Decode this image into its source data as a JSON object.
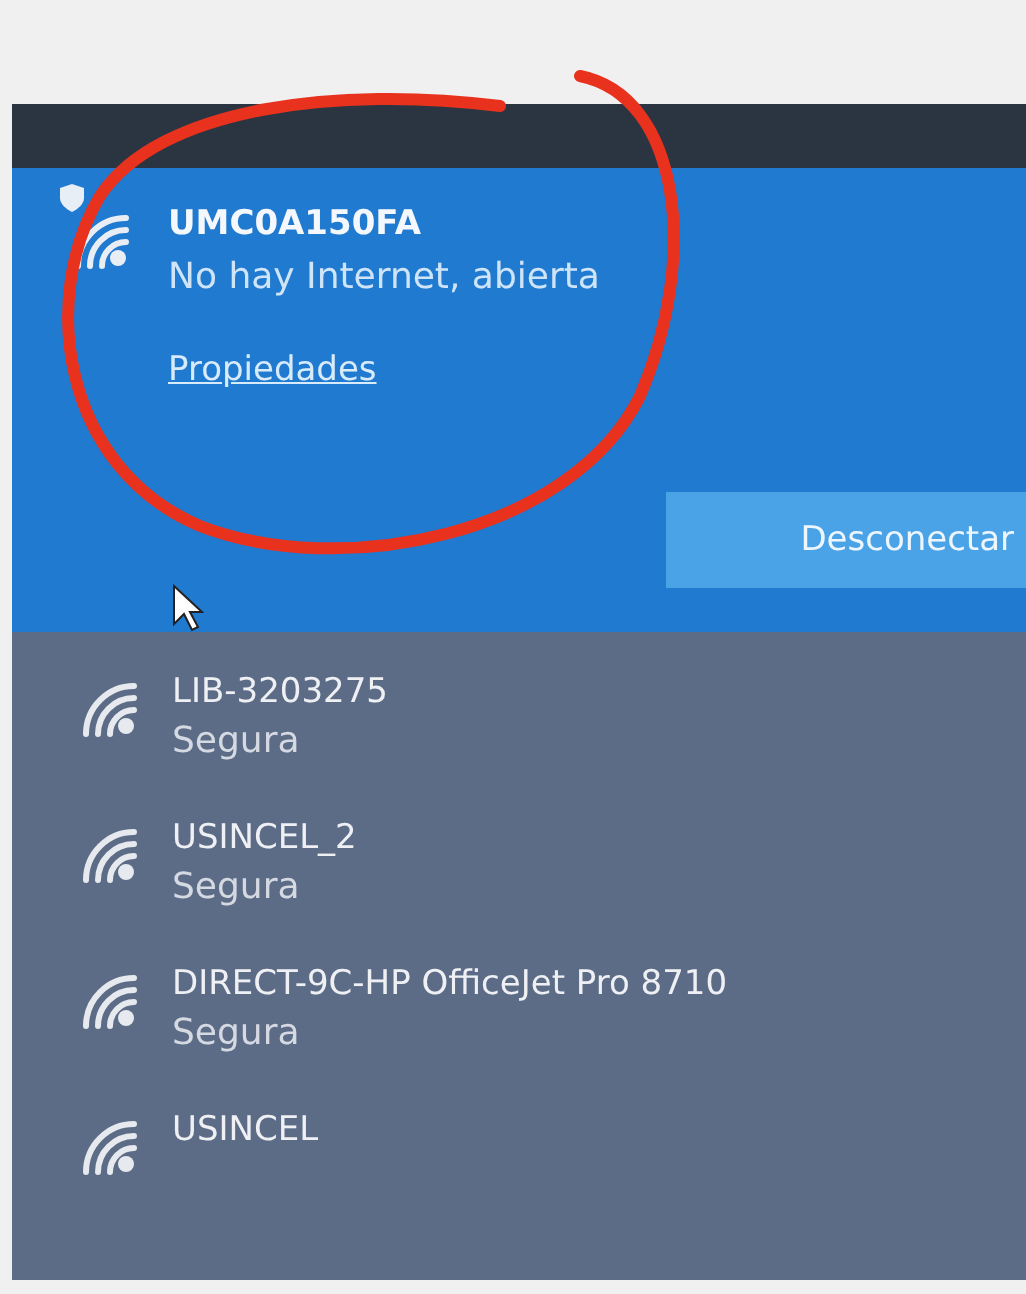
{
  "connected": {
    "name": "UMC0A150FA",
    "status": "No hay Internet, abierta",
    "link": "Propiedades",
    "button": "Desconectar"
  },
  "networks": [
    {
      "name": "LIB-3203275",
      "status": "Segura"
    },
    {
      "name": "USINCEL_2",
      "status": "Segura"
    },
    {
      "name": "DIRECT-9C-HP OfficeJet Pro 8710",
      "status": "Segura"
    },
    {
      "name": "USINCEL"
    }
  ]
}
